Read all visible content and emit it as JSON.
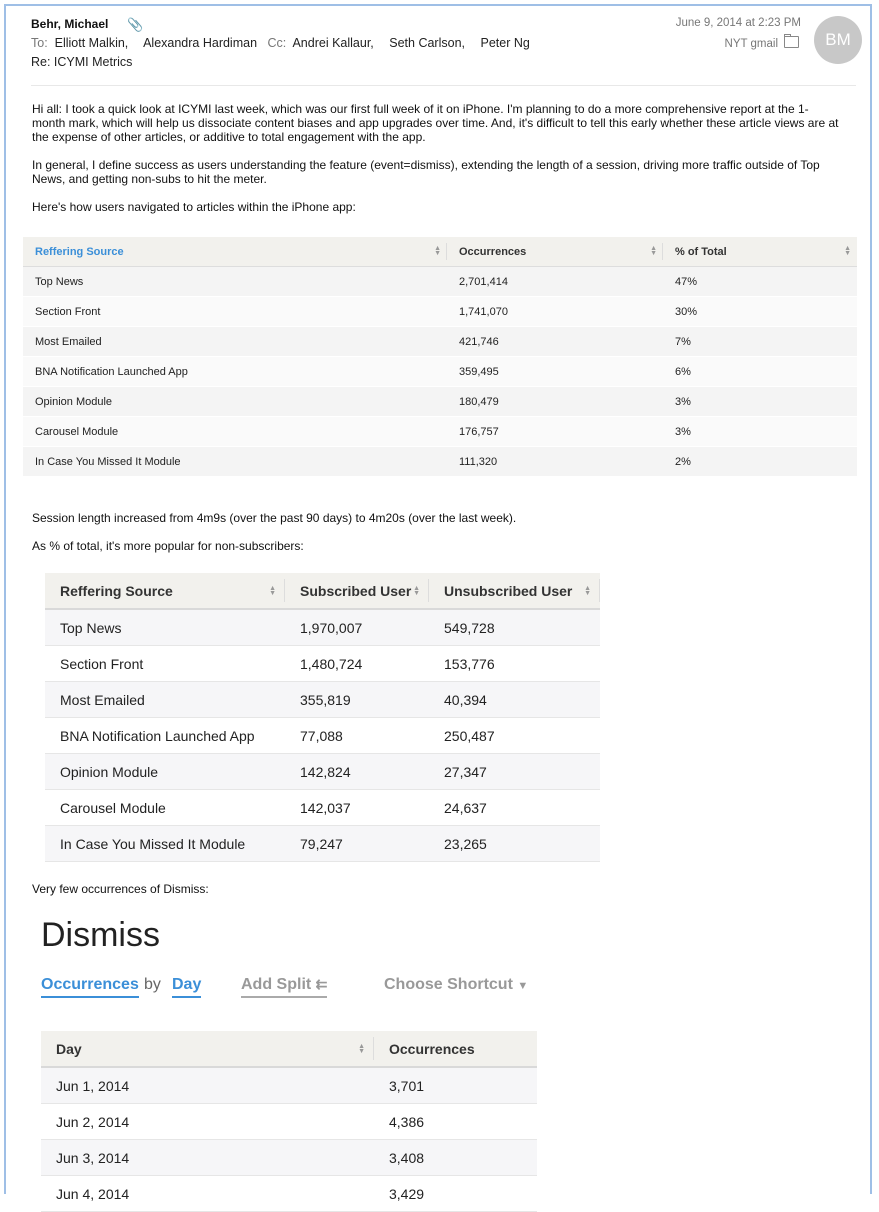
{
  "email": {
    "from": "Behr, Michael",
    "to_label": "To:",
    "to": [
      "Elliott Malkin,",
      "Alexandra Hardiman"
    ],
    "cc_label": "Cc:",
    "cc": [
      "Andrei Kallaur,",
      "Seth Carlson,",
      "Peter Ng"
    ],
    "subject": "Re: ICYMI Metrics",
    "date": "June 9, 2014 at 2:23 PM",
    "account": "NYT gmail",
    "avatar_initials": "BM"
  },
  "body": {
    "p1": "Hi all: I took a quick look at ICYMI last week, which was our first full week of it on iPhone. I'm planning to do a more comprehensive report at the 1-month mark, which will help us dissociate content biases and app upgrades over time. And, it's difficult to tell this early whether these article views are at the expense of other articles, or additive to total engagement with the app.",
    "p2": "In general, I define success as users understanding the feature (event=dismiss), extending the length of a session, driving more traffic outside of Top News, and getting non-subs to hit the meter.",
    "p3": "Here's how users navigated to articles within the iPhone app:",
    "p4": "Session length increased from 4m9s (over the past 90 days) to 4m20s (over the last week).",
    "p5": "As % of total, it's more popular for non-subscribers:",
    "p6": "Very few occurrences of Dismiss:"
  },
  "table1": {
    "headers": [
      "Reffering Source",
      "Occurrences",
      "% of Total"
    ],
    "rows": [
      [
        "Top News",
        "2,701,414",
        "47%"
      ],
      [
        "Section Front",
        "1,741,070",
        "30%"
      ],
      [
        "Most Emailed",
        "421,746",
        "7%"
      ],
      [
        "BNA Notification Launched App",
        "359,495",
        "6%"
      ],
      [
        "Opinion Module",
        "180,479",
        "3%"
      ],
      [
        "Carousel Module",
        "176,757",
        "3%"
      ],
      [
        "In Case You Missed It Module",
        "111,320",
        "2%"
      ]
    ]
  },
  "table2": {
    "headers": [
      "Reffering Source",
      "Subscribed User",
      "Unsubscribed User"
    ],
    "rows": [
      [
        "Top News",
        "1,970,007",
        "549,728"
      ],
      [
        "Section Front",
        "1,480,724",
        "153,776"
      ],
      [
        "Most Emailed",
        "355,819",
        "40,394"
      ],
      [
        "BNA Notification Launched App",
        "77,088",
        "250,487"
      ],
      [
        "Opinion Module",
        "142,824",
        "27,347"
      ],
      [
        "Carousel Module",
        "142,037",
        "24,637"
      ],
      [
        "In Case You Missed It Module",
        "79,247",
        "23,265"
      ]
    ]
  },
  "dismiss": {
    "title": "Dismiss",
    "metric": "Occurrences",
    "by": "by",
    "dimension": "Day",
    "add_split": "Add Split",
    "choose_shortcut": "Choose Shortcut",
    "headers": [
      "Day",
      "Occurrences"
    ],
    "rows": [
      [
        "Jun 1, 2014",
        "3,701"
      ],
      [
        "Jun 2, 2014",
        "4,386"
      ],
      [
        "Jun 3, 2014",
        "3,408"
      ],
      [
        "Jun 4, 2014",
        "3,429"
      ]
    ]
  },
  "colors": {
    "accent": "#3b8fd8",
    "header_bg": "#f2f1ed",
    "frame": "#9fbfe6"
  }
}
